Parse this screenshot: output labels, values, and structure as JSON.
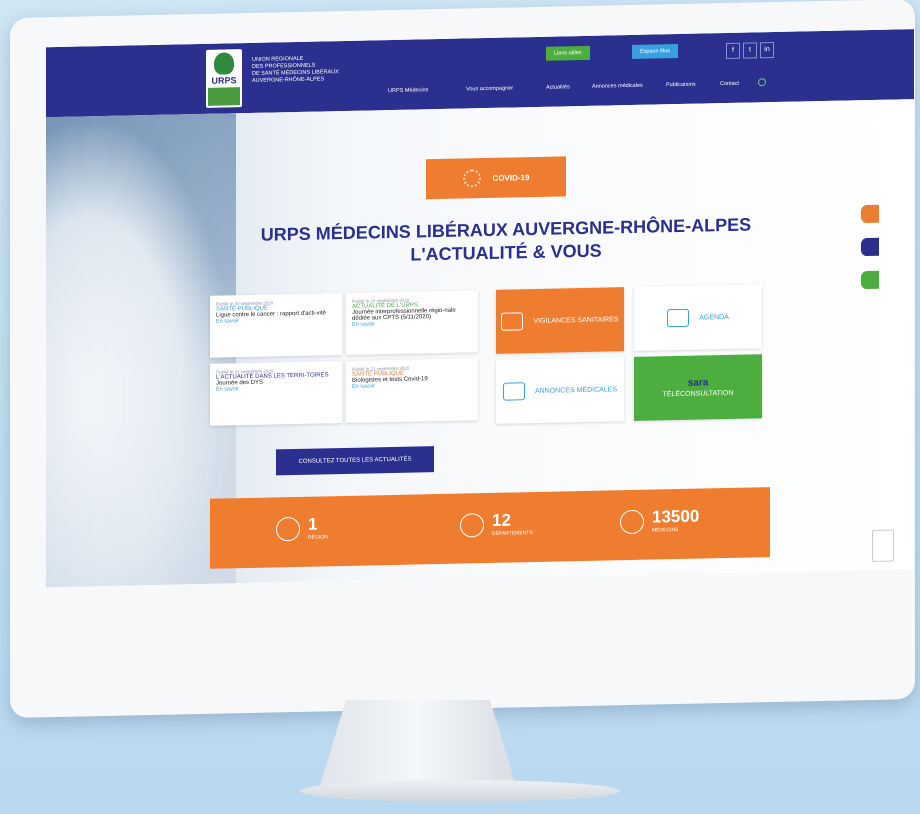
{
  "header": {
    "logo_text": "URPS",
    "org_lines": [
      "UNION RÉGIONALE",
      "DES PROFESSIONNELS",
      "DE SANTÉ MÉDECINS LIBÉRAUX",
      "AUVERGNE-RHÔNE-ALPES"
    ],
    "liens_utiles": "Liens utiles",
    "espace_elus": "Espace élus",
    "social": [
      "f",
      "t",
      "in"
    ],
    "nav": [
      "URPS Médecins",
      "Vous accompagner",
      "Actualités",
      "Annonces médicales",
      "Publications",
      "Contact"
    ]
  },
  "hero": {
    "covid_label": "COVID-19",
    "title_line1": "URPS MÉDECINS LIBÉRAUX AUVERGNE-RHÔNE-ALPES",
    "title_line2": "L'ACTUALITÉ & VOUS"
  },
  "news": [
    {
      "date": "Publié le 30 septembre 2020",
      "category": "SANTÉ PUBLIQUE",
      "title": "Ligue contre le cancer : rapport d'acti-vité",
      "more": "En savoir"
    },
    {
      "date": "Publié le 24 septembre 2020",
      "category": "ACTUALITÉ DE L'URPS",
      "title": "Journée interprofessionnelle régio-nale dédiée aux CPTS (5/11/2020)",
      "more": "En savoir"
    },
    {
      "date": "Publié le 21 septembre 2020",
      "category": "L'ACTUALITÉ DANS LES TERRI-TOIRES",
      "title": "Journée des DYS",
      "more": "En savoir"
    },
    {
      "date": "Publié le 21 septembre 2020",
      "category": "SANTÉ PUBLIQUE",
      "title": "Biologistes et tests Covid-19",
      "more": "En savoir"
    }
  ],
  "tiles": {
    "vigilances": "VIGILANCES SANITAIRES",
    "agenda": "AGENDA",
    "annonces": "ANNONCES MÉDICALES",
    "sara": "sara",
    "teleconsultation": "TÉLÉCONSULTATION"
  },
  "consult_all": "CONSULTEZ TOUTES LES ACTUALITÉS",
  "stats": [
    {
      "value": "1",
      "label": "RÉGION"
    },
    {
      "value": "12",
      "label": "DÉPARTEMENTS"
    },
    {
      "value": "13500",
      "label": "MÉDECINS"
    }
  ],
  "colors": {
    "navy": "#2b2f8e",
    "orange": "#ef7d2f",
    "green": "#4cae3f",
    "blue": "#37a1e0"
  }
}
